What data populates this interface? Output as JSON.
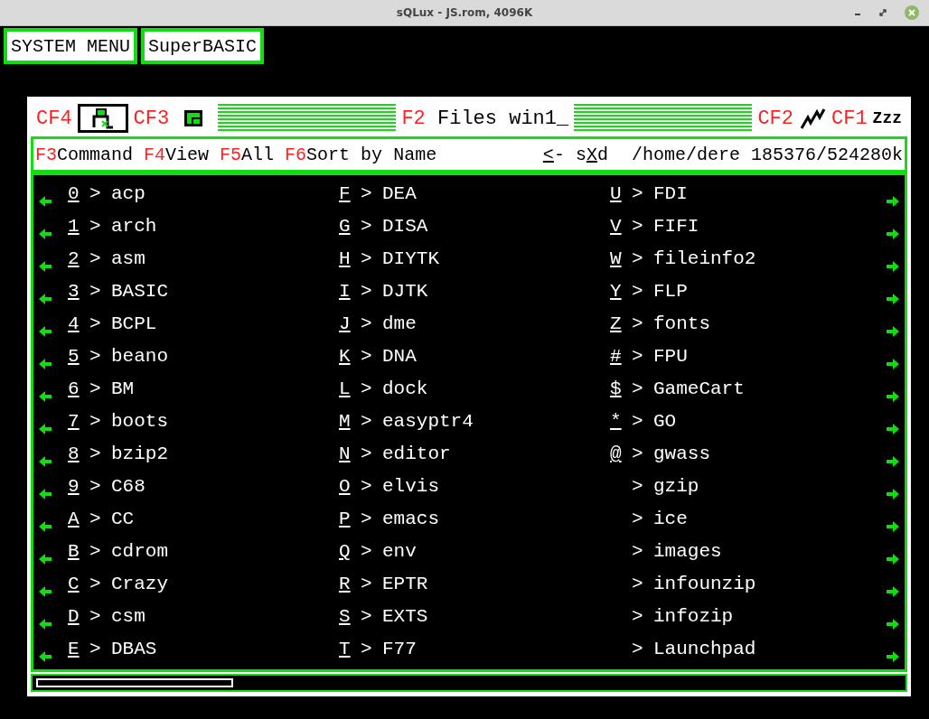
{
  "window": {
    "title": "sQLux - JS.rom, 4096K"
  },
  "top_buttons": [
    "SYSTEM MENU",
    "SuperBASIC"
  ],
  "header": {
    "cf4": "CF4",
    "cf3": "CF3",
    "f2_key": "F2",
    "title": "Files win1_",
    "cf2": "CF2",
    "cf1": "CF1",
    "sleep": "Zzz"
  },
  "command_bar": {
    "items": [
      {
        "key": "F3",
        "label": "Command"
      },
      {
        "key": "F4",
        "label": "View"
      },
      {
        "key": "F5",
        "label": "All"
      },
      {
        "key": "F6",
        "label": "Sort by Name"
      }
    ],
    "parent": {
      "hotkey": "<",
      "rest": "-"
    },
    "sxd": {
      "before": "s",
      "hotkey": "X",
      "after": "d"
    },
    "path": "/home/dere",
    "space": "185376/524280k"
  },
  "columns": [
    [
      {
        "key": "0",
        "name": "acp"
      },
      {
        "key": "1",
        "name": "arch"
      },
      {
        "key": "2",
        "name": "asm"
      },
      {
        "key": "3",
        "name": "BASIC"
      },
      {
        "key": "4",
        "name": "BCPL"
      },
      {
        "key": "5",
        "name": "beano"
      },
      {
        "key": "6",
        "name": "BM"
      },
      {
        "key": "7",
        "name": "boots"
      },
      {
        "key": "8",
        "name": "bzip2"
      },
      {
        "key": "9",
        "name": "C68"
      },
      {
        "key": "A",
        "name": "CC"
      },
      {
        "key": "B",
        "name": "cdrom"
      },
      {
        "key": "C",
        "name": "Crazy"
      },
      {
        "key": "D",
        "name": "csm"
      },
      {
        "key": "E",
        "name": "DBAS"
      }
    ],
    [
      {
        "key": "F",
        "name": "DEA"
      },
      {
        "key": "G",
        "name": "DISA"
      },
      {
        "key": "H",
        "name": "DIYTK"
      },
      {
        "key": "I",
        "name": "DJTK"
      },
      {
        "key": "J",
        "name": "dme"
      },
      {
        "key": "K",
        "name": "DNA"
      },
      {
        "key": "L",
        "name": "dock"
      },
      {
        "key": "M",
        "name": "easyptr4"
      },
      {
        "key": "N",
        "name": "editor"
      },
      {
        "key": "O",
        "name": "elvis"
      },
      {
        "key": "P",
        "name": "emacs"
      },
      {
        "key": "Q",
        "name": "env"
      },
      {
        "key": "R",
        "name": "EPTR"
      },
      {
        "key": "S",
        "name": "EXTS"
      },
      {
        "key": "T",
        "name": "F77"
      }
    ],
    [
      {
        "key": "U",
        "name": "FDI"
      },
      {
        "key": "V",
        "name": "FIFI"
      },
      {
        "key": "W",
        "name": "fileinfo2"
      },
      {
        "key": "Y",
        "name": "FLP"
      },
      {
        "key": "Z",
        "name": "fonts"
      },
      {
        "key": "#",
        "name": "FPU"
      },
      {
        "key": "$",
        "name": "GameCart"
      },
      {
        "key": "*",
        "name": "GO"
      },
      {
        "key": "@",
        "name": "gwass"
      },
      {
        "name": "gzip"
      },
      {
        "name": "ice"
      },
      {
        "name": "images"
      },
      {
        "name": "infounzip"
      },
      {
        "name": "infozip"
      },
      {
        "name": "Launchpad"
      }
    ]
  ],
  "entry_marker": ">"
}
